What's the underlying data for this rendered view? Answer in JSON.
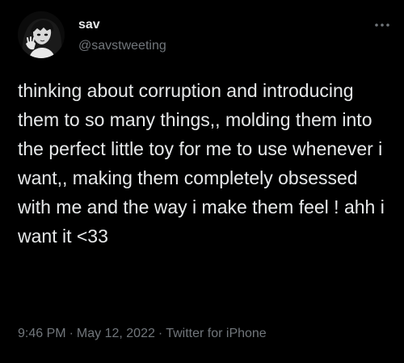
{
  "author": {
    "name": "sav",
    "handle": "@savstweeting"
  },
  "avatar": {
    "icon": "profile-avatar-icon"
  },
  "more": {
    "icon": "more-options-icon"
  },
  "tweet": {
    "text": "thinking about corruption and introducing them to so many things,, molding them into the perfect little toy for me to use whenever i want,, making them completely obsessed with me and the way i make them feel ! ahh i want it <33"
  },
  "meta": {
    "time": "9:46 PM",
    "separator_1": "·",
    "date": "May 12, 2022",
    "separator_2": "·",
    "source": "Twitter for iPhone"
  },
  "colors": {
    "background": "#000000",
    "primary_text": "#e7e9ea",
    "secondary_text": "#71767b"
  }
}
